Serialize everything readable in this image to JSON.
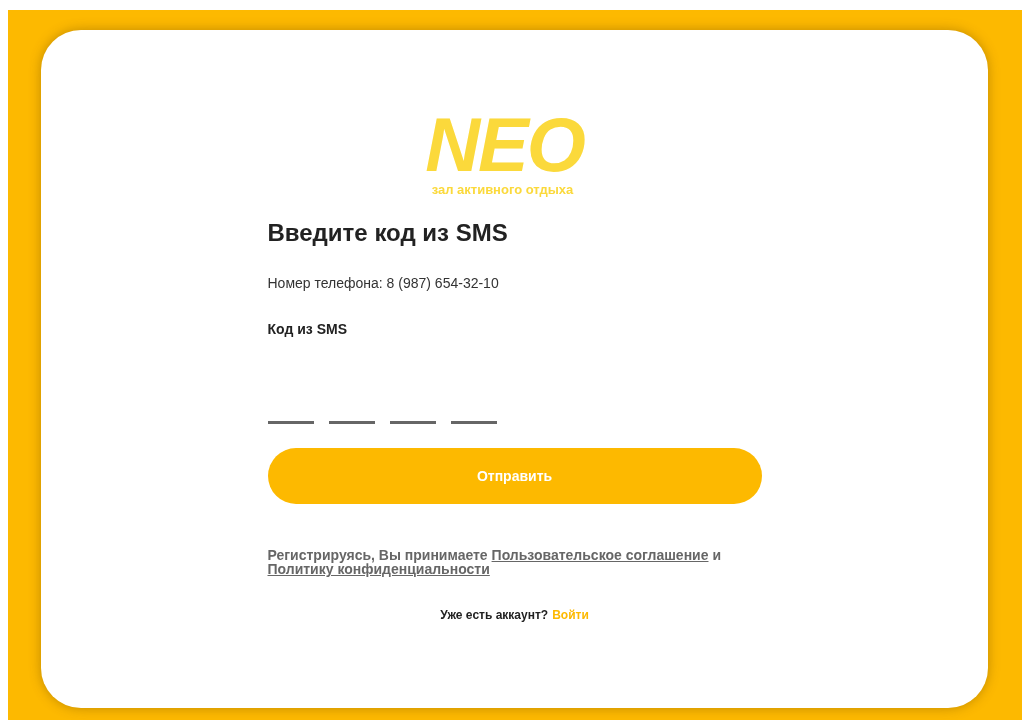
{
  "logo": {
    "name": "NEO",
    "tagline": "зал активного отдыха"
  },
  "title": "Введите код из SMS",
  "phone_line": "Номер телефона: 8 (987) 654-32-10",
  "code_label": "Код из SMS",
  "code_inputs": [
    {
      "kind": "digit"
    },
    {
      "kind": "digit"
    },
    {
      "kind": "digit"
    },
    {
      "kind": "digit"
    }
  ],
  "submit_button": "Отправить",
  "consent": {
    "text": "Регистрируясь, Вы принимаете",
    "link_1": "Пользовательское соглашение",
    "joiner": "и",
    "link_2": "Политику конфиденциальности"
  },
  "login": {
    "text": "Уже есть аккаунт?",
    "link": "Войти"
  }
}
